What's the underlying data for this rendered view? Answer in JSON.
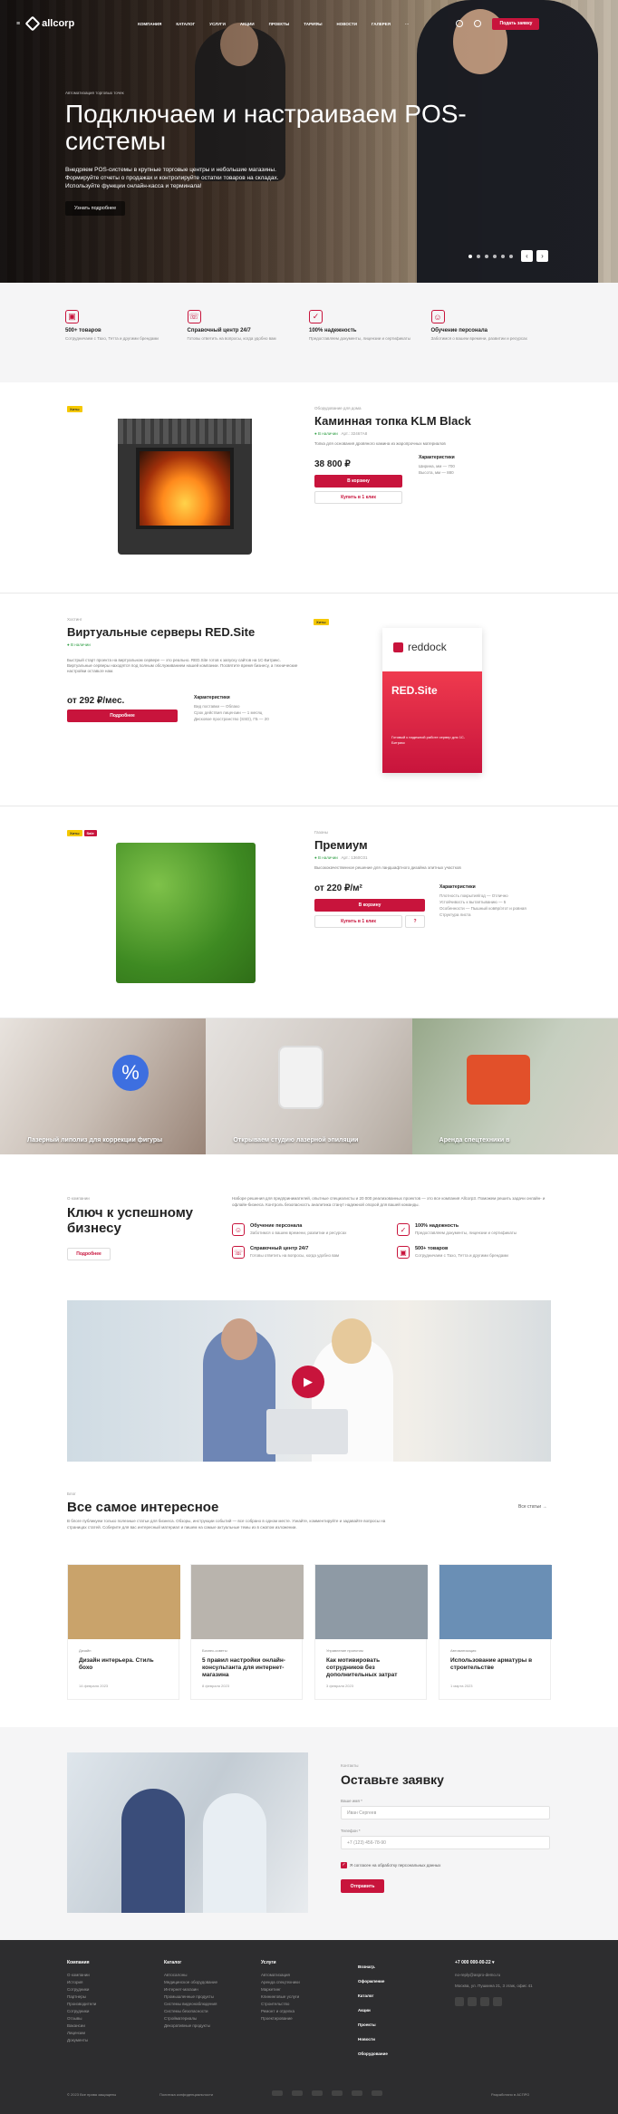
{
  "nav": {
    "logo": "allcorp",
    "menu": [
      "КОМПАНИЯ",
      "КАТАЛОГ",
      "УСЛУГИ",
      "АКЦИИ",
      "ПРОЕКТЫ",
      "ТАРИФЫ",
      "НОВОСТИ",
      "ГАЛЕРЕЯ",
      "···"
    ],
    "cta": "Подать заявку"
  },
  "hero": {
    "crumb": "Автоматизация торговых точек",
    "title": "Подключаем и настраиваем POS-системы",
    "text": "Внедряем POS-системы в крупные торговые центры и небольшие магазины. Формируйте отчеты о продажах и контролируйте остатки товаров на складах. Используйте функции онлайн-касса и терминала!",
    "more": "Узнать подробнее",
    "dots": 6,
    "active_dot": 0
  },
  "features": [
    {
      "icon": "box-icon",
      "title": "500+ товаров",
      "desc": "Сотрудничаем с Тахо, Тетта и другими брендами"
    },
    {
      "icon": "phone-icon",
      "title": "Справочный центр 24/7",
      "desc": "Готовы ответить на вопросы, когда удобно вам"
    },
    {
      "icon": "check-icon",
      "title": "100% надежность",
      "desc": "Предоставляем документы, лицензии и сертификаты"
    },
    {
      "icon": "users-icon",
      "title": "Обучение персонала",
      "desc": "Заботимся о вашем времени, развитии и ресурсах"
    }
  ],
  "product1": {
    "badge": "Хиты",
    "crumb": "Оборудование для дома",
    "title": "Каминная топка KLM Black",
    "instock": "● В наличии",
    "art": "Арт.: 32467A8",
    "desc": "Топка для основания дровяного камина из жаропрочных материалов",
    "price": "38 800 ₽",
    "cart": "В корзину",
    "buy": "Купить в 1 клик",
    "char_title": "Характеристики",
    "chars": [
      "Ширина, мм — 700",
      "Высота, мм — 880"
    ]
  },
  "product2": {
    "crumb": "Хостинг",
    "title": "Виртуальные серверы RED.Site",
    "instock": "● В наличии",
    "desc": "Быстрый старт проекта на виртуальном сервере — это реально. RED.Site готов к запуску сайтов на 1С-Битрикс. Виртуальные серверы находятся под полным обслуживанием нашей компании. Посвятите время бизнесу, а технические настройки оставьте нам.",
    "price": "от 292 ₽/мес.",
    "more": "Подробнее",
    "char_title": "Характеристики",
    "chars": [
      "Вид поставки — Облако",
      "Срок действия лицензии — 1 месяц",
      "Дисковое пространство (SSD), ГБ — 20"
    ],
    "badge": "Хиты",
    "box_brand": "reddock",
    "box_title": "RED.Site",
    "box_text": "Готовый к надежной работе сервер для 1С-Битрикс"
  },
  "product3": {
    "badges": [
      "Хиты",
      "Sale"
    ],
    "crumb": "Газоны",
    "title": "Премиум",
    "instock": "● В наличии",
    "art": "Арт.: 1360C01",
    "desc": "Высококачественное решение для ландшафтного дизайна элитных участков",
    "price": "от 220 ₽/м²",
    "cart": "В корзину",
    "buy": "Купить в 1 клик",
    "char_title": "Характеристики",
    "chars": [
      "Плотность покрытия/год — Отлично",
      "Устойчивость к вытаптыванию — 5",
      "Особенности — Пышный ковёр/этот и ровная",
      "Структура листа"
    ]
  },
  "banners": [
    "Лазерный липолиз для коррекции фигуры",
    "Открываем студию лазерной эпиляции",
    "Аренда спецтехники в"
  ],
  "about": {
    "crumb": "О компании",
    "title": "Ключ к успешному бизнесу",
    "more": "Подробнее",
    "text": "Наборе решения для предпринимателей, опытные специалисты и 20 000 реализованных проектов — это все компания Allcorp3. Поможем решить задачи онлайн- и офлайн-бизнеса. Контроль безопасность аналитика станут надежной опорой для вашей команды.",
    "items": [
      {
        "icon": "users-icon",
        "title": "Обучение персонала",
        "desc": "Заботимся о вашем времени, развитии и ресурсах"
      },
      {
        "icon": "check-icon",
        "title": "100% надежность",
        "desc": "Предоставляем документы, лицензии и сертификаты"
      },
      {
        "icon": "phone-icon",
        "title": "Справочный центр 24/7",
        "desc": "Готовы ответить на вопросы, когда удобно вам"
      },
      {
        "icon": "box-icon",
        "title": "500+ товаров",
        "desc": "Сотрудничаем с Тахо, Тетта и другими брендами"
      }
    ]
  },
  "blog": {
    "crumb": "Блог",
    "title": "Все самое интересное",
    "all": "Все статьи →",
    "text": "В блоге публикуем только полезные статьи для бизнеса. Обзоры, инструкции событий — все собрано в одном месте. Узнайте, комментируйте и задавайте вопросы на страницах статей. Соберите для вас интересный материал и пишем на самые актуальные темы из в сжатом изложении.",
    "cards": [
      {
        "cat": "Дизайн",
        "title": "Дизайн интерьера. Стиль бохо",
        "date": "14 февраля 2023",
        "color": "#c9a36b"
      },
      {
        "cat": "Бизнес-советы",
        "title": "5 правил настройки онлайн-консультанта для интернет-магазина",
        "date": "8 февраля 2023",
        "color": "#b9b4ad"
      },
      {
        "cat": "Управление проектом",
        "title": "Как мотивировать сотрудников без дополнительных затрат",
        "date": "3 февраля 2023",
        "color": "#8e9aa5"
      },
      {
        "cat": "Автоматизация",
        "title": "Использование арматуры в строительстве",
        "date": "1 марта 2023",
        "color": "#6a8fb5"
      }
    ]
  },
  "form": {
    "crumb": "Контакты",
    "title": "Оставьте заявку",
    "name_label": "Ваше имя *",
    "name_ph": "Иван Сергеев",
    "phone_label": "Телефон *",
    "phone_ph": "+7 (123) 456-78-90",
    "agree": "Я согласен на обработку персональных данных",
    "submit": "Отправить"
  },
  "footer": {
    "cols": [
      {
        "title": "Компания",
        "links": [
          "О компании",
          "История",
          "Сотрудники",
          "Партнеры",
          "Производители",
          "Сотрудники",
          "Отзывы",
          "Вакансии",
          "Лицензии",
          "Документы"
        ]
      },
      {
        "title": "Каталог",
        "links": [
          "Автосалоны",
          "Медицинское оборудование",
          "Интернет-магазин",
          "Промышленные продукты",
          "Системы видеонаблюдения",
          "Системы безопасности",
          "Стройматериалы",
          "Декоративные продукты"
        ]
      },
      {
        "title": "Услуги",
        "links": [
          "Автоматизация",
          "Аренда спецтехники",
          "Маркетинг",
          "Клининговые услуги",
          "Строительство",
          "Ремонт и отделка",
          "Проектирование"
        ]
      },
      {
        "title": "",
        "links": [
          "Вознагр.",
          "Оформление",
          "Каталог",
          "Акции",
          "Проекты",
          "Новости",
          "Оборудование"
        ]
      }
    ],
    "phone": "+7 000 000-00-22 ▾",
    "email": "no-reply@aspro-demo.ru",
    "address": "Москва, ул. Пушкина 21, 3 этаж, офис 41",
    "copy": "© 2023 Все права защищены",
    "policy": "Политика конфиденциальности",
    "dev": "Разработано в  АСПРО"
  }
}
